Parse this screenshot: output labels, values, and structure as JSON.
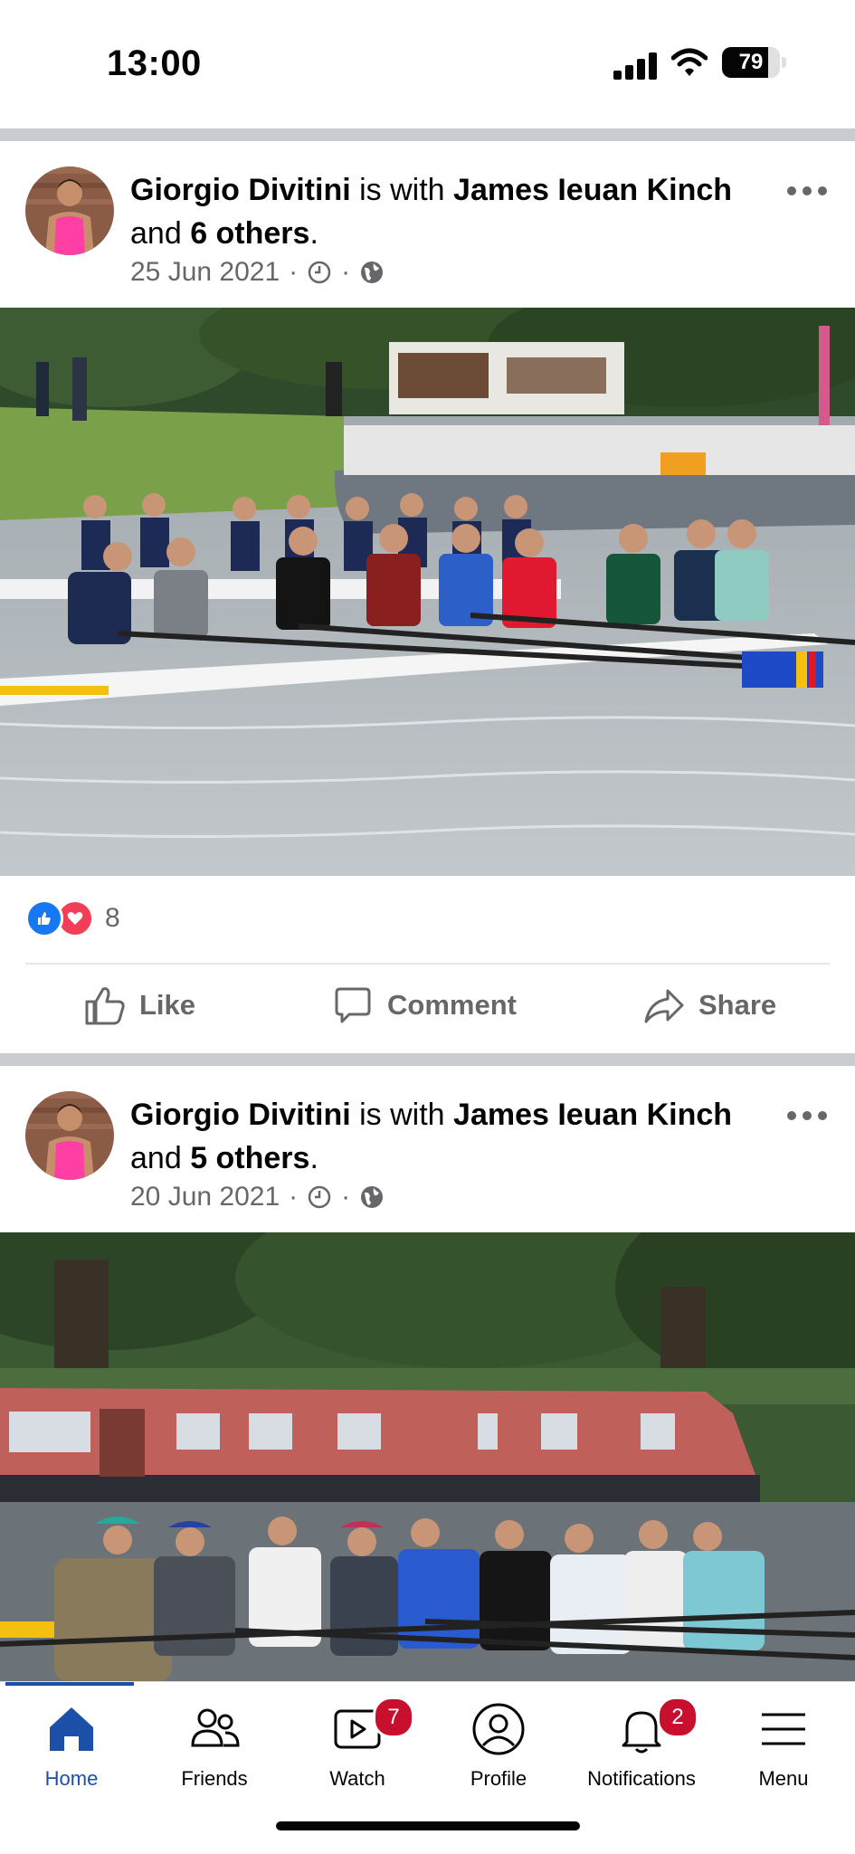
{
  "status_bar": {
    "time": "13:00",
    "battery": "79",
    "battery_level": 0.79
  },
  "posts": [
    {
      "author": "Giorgio Divitini",
      "connector": " is with ",
      "tagged": "James Ieuan Kinch",
      "and_text": " and ",
      "others": "6 others",
      "period": ".",
      "date": "25 Jun 2021",
      "sep": "·",
      "reaction_count": "8",
      "icons": [
        "clock-icon",
        "globe-icon"
      ]
    },
    {
      "author": "Giorgio Divitini",
      "connector": " is with ",
      "tagged": "James Ieuan Kinch",
      "and_text": " and ",
      "others": "5 others",
      "period": ".",
      "date": "20 Jun 2021",
      "sep": "·",
      "icons": [
        "clock-icon",
        "globe-icon"
      ]
    }
  ],
  "actions": {
    "like": "Like",
    "comment": "Comment",
    "share": "Share"
  },
  "nav": [
    {
      "label": "Home",
      "icon": "home-icon",
      "active": true
    },
    {
      "label": "Friends",
      "icon": "friends-icon"
    },
    {
      "label": "Watch",
      "icon": "watch-icon",
      "badge": "7"
    },
    {
      "label": "Profile",
      "icon": "profile-icon"
    },
    {
      "label": "Notifications",
      "icon": "bell-icon",
      "badge": "2"
    },
    {
      "label": "Menu",
      "icon": "menu-icon"
    }
  ],
  "colors": {
    "facebook_blue": "#1877f2",
    "nav_active": "#1b4fa8",
    "badge_red": "#c8102e",
    "love_red": "#f33e58"
  }
}
